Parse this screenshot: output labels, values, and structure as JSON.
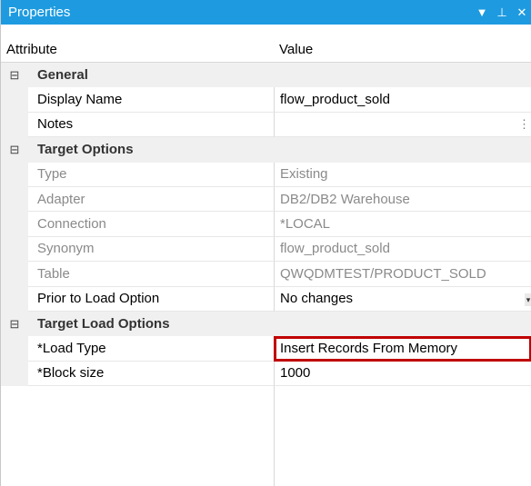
{
  "panel": {
    "title": "Properties",
    "controls": {
      "dropdown": "▼",
      "pin": "⊥",
      "close": "✕"
    }
  },
  "header": {
    "attribute": "Attribute",
    "value": "Value"
  },
  "rows": [
    {
      "type": "category",
      "toggle": "⊟",
      "label": "General"
    },
    {
      "type": "prop",
      "label": "Display Name",
      "value": "flow_product_sold",
      "enabled": true
    },
    {
      "type": "prop",
      "label": "Notes",
      "value": "",
      "enabled": true,
      "ellipsis": "⋮"
    },
    {
      "type": "category",
      "toggle": "⊟",
      "label": "Target Options"
    },
    {
      "type": "prop",
      "label": "Type",
      "value": "Existing",
      "enabled": false
    },
    {
      "type": "prop",
      "label": "Adapter",
      "value": "DB2/DB2 Warehouse",
      "enabled": false
    },
    {
      "type": "prop",
      "label": "Connection",
      "value": "*LOCAL",
      "enabled": false
    },
    {
      "type": "prop",
      "label": "Synonym",
      "value": "flow_product_sold",
      "enabled": false
    },
    {
      "type": "prop",
      "label": "Table",
      "value": "QWQDMTEST/PRODUCT_SOLD",
      "enabled": false
    },
    {
      "type": "prop",
      "label": "Prior to Load Option",
      "value": "No changes",
      "enabled": true,
      "dropdown": "▾"
    },
    {
      "type": "category",
      "toggle": "⊟",
      "label": "Target Load Options"
    },
    {
      "type": "prop",
      "label": "*Load Type",
      "value": "Insert Records From Memory",
      "enabled": true,
      "highlight_color": "#c00000"
    },
    {
      "type": "prop",
      "label": "*Block size",
      "value": "1000",
      "enabled": true
    }
  ],
  "colors": {
    "titlebar": "#1e9be0",
    "category_bg": "#f0f0f0",
    "highlight": "#c00000"
  }
}
